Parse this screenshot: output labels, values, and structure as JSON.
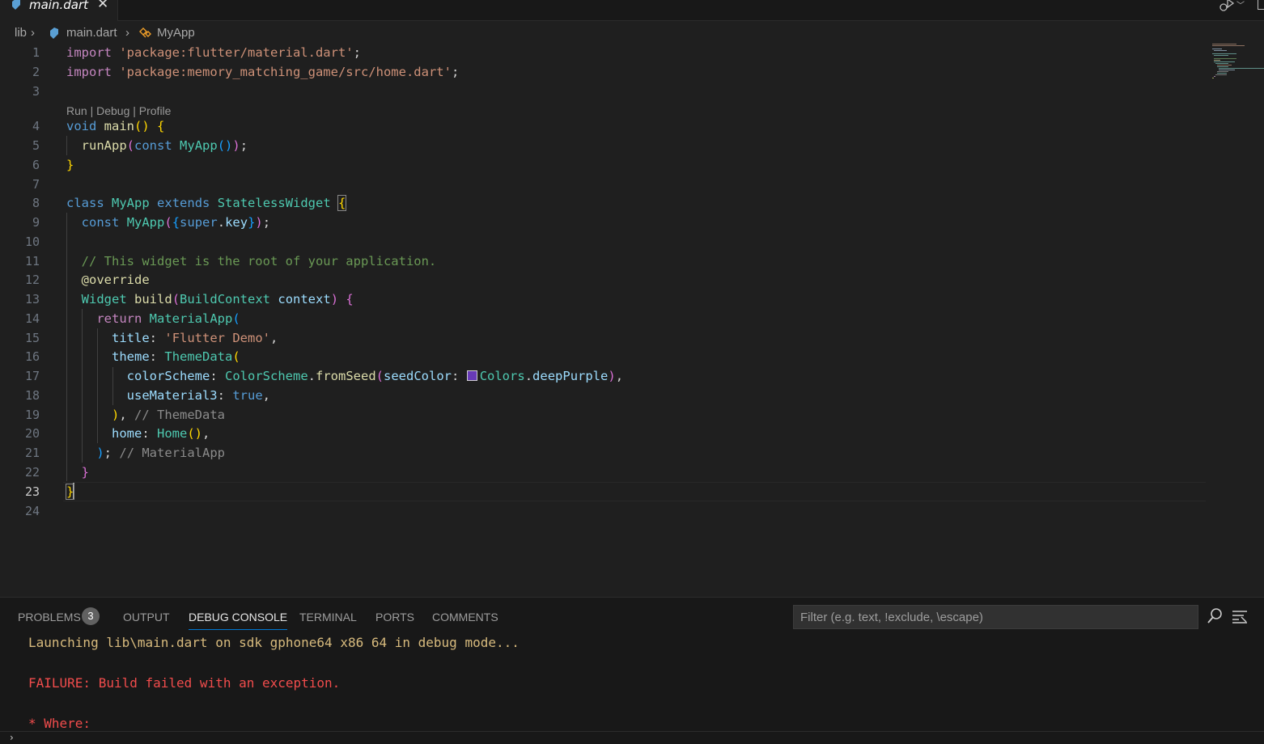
{
  "tab": {
    "filename": "main.dart",
    "close": "✕"
  },
  "breadcrumb": {
    "folder": "lib",
    "file": "main.dart",
    "symbol": "MyApp"
  },
  "editor": {
    "codelens": "Run | Debug | Profile",
    "line_numbers": [
      "1",
      "2",
      "3",
      "4",
      "5",
      "6",
      "7",
      "8",
      "9",
      "10",
      "11",
      "12",
      "13",
      "14",
      "15",
      "16",
      "17",
      "18",
      "19",
      "20",
      "21",
      "22",
      "23",
      "24"
    ],
    "active_line": "23"
  },
  "panel": {
    "tabs": {
      "problems": "PROBLEMS",
      "output": "OUTPUT",
      "debug_console": "DEBUG CONSOLE",
      "terminal": "TERMINAL",
      "ports": "PORTS",
      "comments": "COMMENTS"
    },
    "problems_count": "3",
    "filter_placeholder": "Filter (e.g. text, !exclude, \\escape)",
    "console": [
      "Launching lib\\main.dart on sdk gphone64 x86 64 in debug mode...",
      "FAILURE: Build failed with an exception.",
      "* Where:"
    ]
  },
  "colors": {
    "accent": "#0078d4",
    "swatch": "#673ab7",
    "error": "#f14c4c",
    "warning": "#d7ba7d"
  },
  "icons": [
    "dart-file-icon",
    "close-icon",
    "run-debug-icon",
    "split-editor-icon",
    "class-symbol-icon",
    "filter-icon",
    "word-wrap-icon"
  ]
}
